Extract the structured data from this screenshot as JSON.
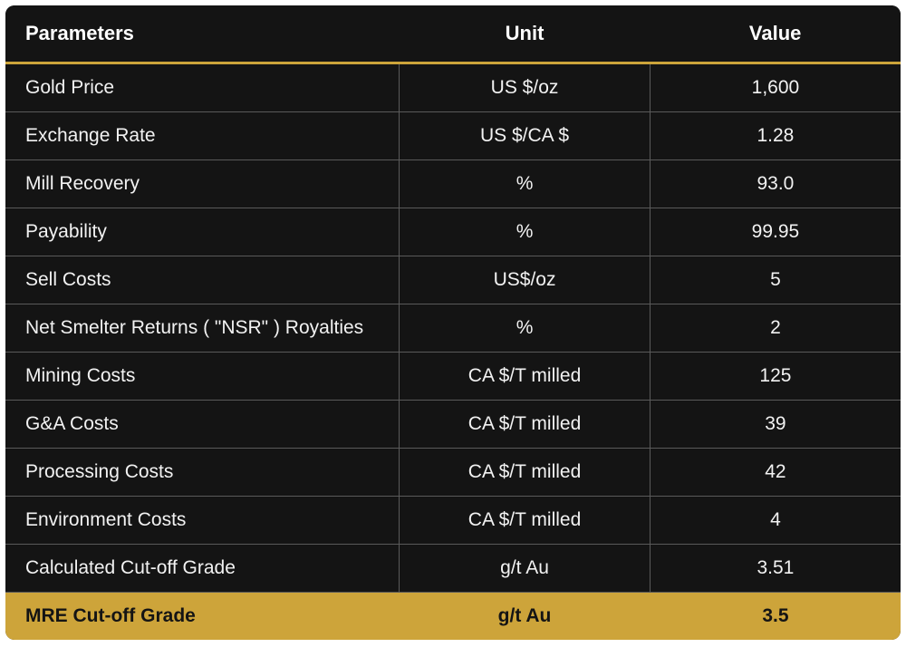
{
  "colors": {
    "accent": "#cda43a",
    "background": "#141414",
    "text": "#ffffff"
  },
  "headers": {
    "parameters": "Parameters",
    "unit": "Unit",
    "value": "Value"
  },
  "rows": [
    {
      "param": "Gold Price",
      "unit": "US $/oz",
      "value": "1,600",
      "highlight": false
    },
    {
      "param": "Exchange Rate",
      "unit": "US $/CA $",
      "value": "1.28",
      "highlight": false
    },
    {
      "param": "Mill Recovery",
      "unit": "%",
      "value": "93.0",
      "highlight": false
    },
    {
      "param": "Payability",
      "unit": "%",
      "value": "99.95",
      "highlight": false
    },
    {
      "param": "Sell Costs",
      "unit": "US$/oz",
      "value": "5",
      "highlight": false
    },
    {
      "param": "Net Smelter Returns ( \"NSR\" ) Royalties",
      "unit": "%",
      "value": "2",
      "highlight": false
    },
    {
      "param": "Mining Costs",
      "unit": "CA $/T milled",
      "value": "125",
      "highlight": false
    },
    {
      "param": "G&A Costs",
      "unit": "CA $/T milled",
      "value": "39",
      "highlight": false
    },
    {
      "param": "Processing Costs",
      "unit": "CA $/T milled",
      "value": "42",
      "highlight": false
    },
    {
      "param": "Environment Costs",
      "unit": "CA $/T milled",
      "value": "4",
      "highlight": false
    },
    {
      "param": "Calculated Cut-off Grade",
      "unit": "g/t Au",
      "value": "3.51",
      "highlight": false
    },
    {
      "param": "MRE Cut-off Grade",
      "unit": "g/t Au",
      "value": "3.5",
      "highlight": true
    }
  ]
}
